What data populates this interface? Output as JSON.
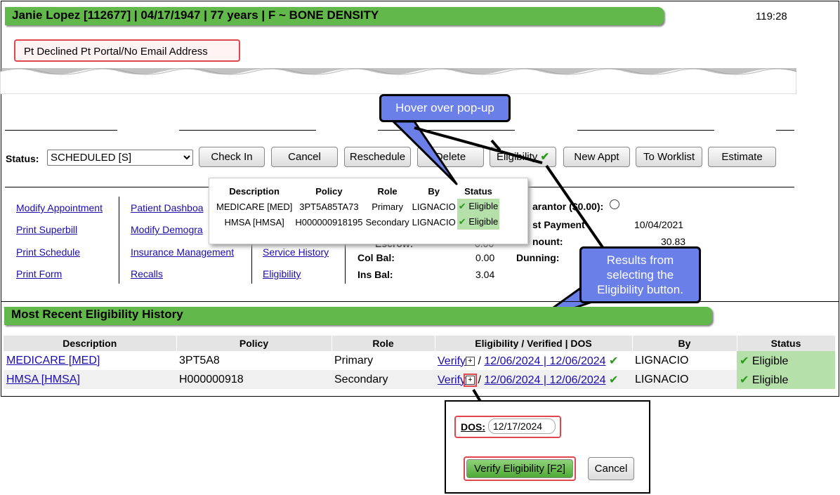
{
  "header": {
    "title": "Janie Lopez [112677] | 04/17/1947 | 77 years | F  ~  BONE DENSITY",
    "timer": "119:28"
  },
  "alert": "Pt Declined Pt Portal/No Email Address",
  "status": {
    "label": "Status:",
    "value": "SCHEDULED [S]"
  },
  "buttons": {
    "check_in": "Check In",
    "cancel": "Cancel",
    "reschedule": "Reschedule",
    "delete": "Delete",
    "eligibility": "Eligibility",
    "new_appt": "New Appt",
    "to_worklist": "To Worklist",
    "estimate": "Estimate"
  },
  "links_col1": [
    "Modify Appointment",
    "Print Superbill",
    "Print Schedule",
    "Print Form"
  ],
  "links_col2": [
    "Patient Dashboa",
    "Modify Demogra",
    "Insurance Management",
    "Recalls"
  ],
  "links_col3": [
    "Service History",
    "Eligibility"
  ],
  "balances": {
    "escrow_label": "Escrow:",
    "escrow_value": "0.00",
    "col_label": "Col Bal:",
    "col_value": "0.00",
    "ins_label": "Ins Bal:",
    "ins_value": "3.04"
  },
  "account": {
    "guarantor_label": "arantor ($0.00):",
    "last_payment_label": "st Payment",
    "last_payment_value": "10/04/2021",
    "amount_label": "nount:",
    "amount_value": "30.83",
    "dunning_label": "Dunning:"
  },
  "popup": {
    "headers": [
      "Description",
      "Policy",
      "Role",
      "By",
      "Status"
    ],
    "rows": [
      [
        "MEDICARE [MED]",
        "3PT5A85TA73",
        "Primary",
        "LIGNACIO",
        "Eligible"
      ],
      [
        "HMSA [HMSA]",
        "H000000918195",
        "Secondary",
        "LIGNACIO",
        "Eligible"
      ]
    ]
  },
  "callouts": {
    "hover": "Hover over pop-up",
    "results": "Results from selecting the Eligibility button."
  },
  "history": {
    "title": "Most Recent Eligibility History",
    "headers": [
      "Description",
      "Policy",
      "Role",
      "Eligibility / Verified | DOS",
      "By",
      "Status"
    ],
    "rows": [
      {
        "description": "MEDICARE [MED]",
        "policy": "3PT5A8",
        "role": "Primary",
        "verify": "Verify",
        "dates": "12/06/2024 | 12/06/2024",
        "by": "LIGNACIO",
        "status": "Eligible"
      },
      {
        "description": "HMSA [HMSA]",
        "policy": "H000000918",
        "role": "Secondary",
        "verify": "Verify",
        "dates": "12/06/2024 | 12/06/2024",
        "by": "LIGNACIO",
        "status": "Eligible"
      }
    ]
  },
  "dos": {
    "label": "DOS:",
    "value": "12/17/2024",
    "verify_button": "Verify Eligibility [F2]",
    "cancel_button": "Cancel"
  },
  "colors": {
    "accent_green": "#62b84a",
    "callout_blue": "#6a7fe8",
    "highlight_red": "#e0474c",
    "eligible_bg": "#b5e0a9"
  }
}
